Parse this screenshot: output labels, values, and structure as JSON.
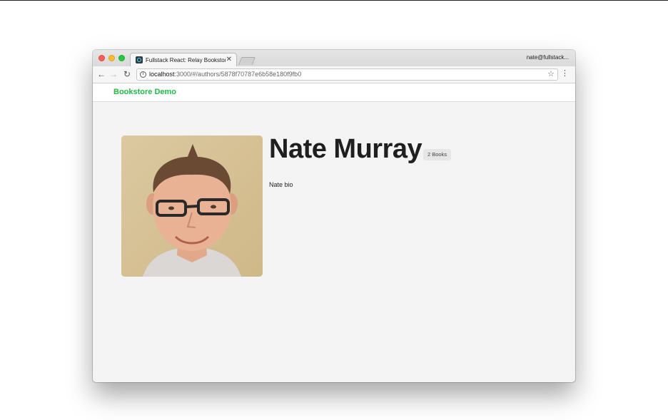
{
  "browser": {
    "tab_title": "Fullstack React: Relay Bookstore",
    "tab_close": "✕",
    "profile_name": "nate@fullstack...",
    "url_host": "localhost",
    "url_rest": ":3000/#/authors/5878f70787e6b58e180f9fb0",
    "icons": {
      "back": "arrow-left",
      "forward": "arrow-right",
      "reload": "reload",
      "info": "info",
      "star": "star",
      "menu": "vertical-dots"
    }
  },
  "app": {
    "brand": "Bookstore Demo",
    "brand_color": "#21ba45"
  },
  "author": {
    "name": "Nate Murray",
    "books_badge": "2 Books",
    "bio": "Nate bio"
  }
}
